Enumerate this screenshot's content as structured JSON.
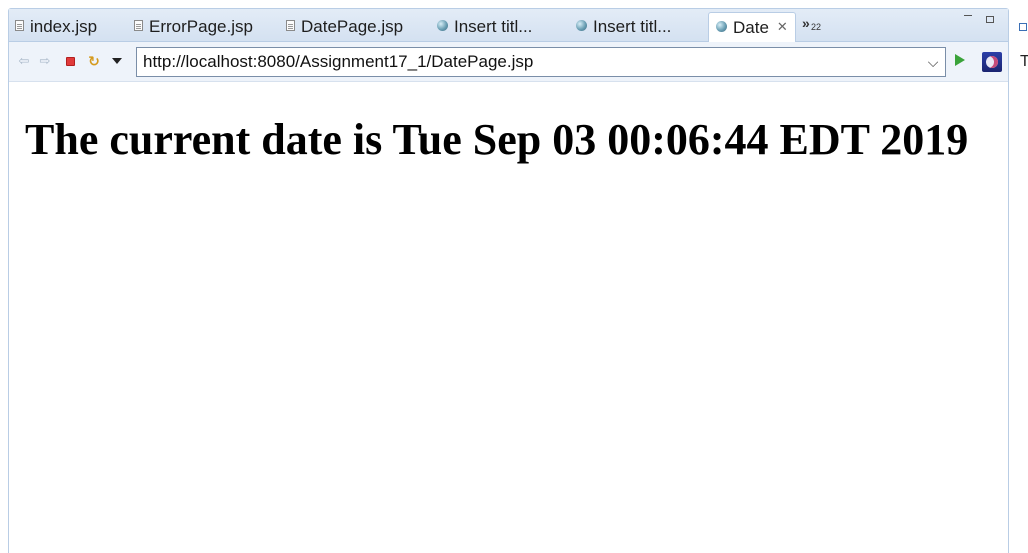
{
  "tabs": [
    {
      "label": "index.jsp",
      "icon": "jsp-file-icon",
      "active": false
    },
    {
      "label": "ErrorPage.jsp",
      "icon": "jsp-file-icon",
      "active": false
    },
    {
      "label": "DatePage.jsp",
      "icon": "jsp-file-icon",
      "active": false
    },
    {
      "label": "Insert titl...",
      "icon": "browser-globe-icon",
      "active": false
    },
    {
      "label": "Insert titl...",
      "icon": "browser-globe-icon",
      "active": false
    },
    {
      "label": "Date",
      "icon": "browser-globe-icon",
      "active": true,
      "close": "✕"
    }
  ],
  "overflow": {
    "chevron": "»",
    "count": "22"
  },
  "browser": {
    "url": "http://localhost:8080/Assignment17_1/DatePage.jsp"
  },
  "page": {
    "heading": "The current date is Tue Sep 03 00:06:44 EDT 2019"
  },
  "right_panel": {
    "letter": "T"
  }
}
